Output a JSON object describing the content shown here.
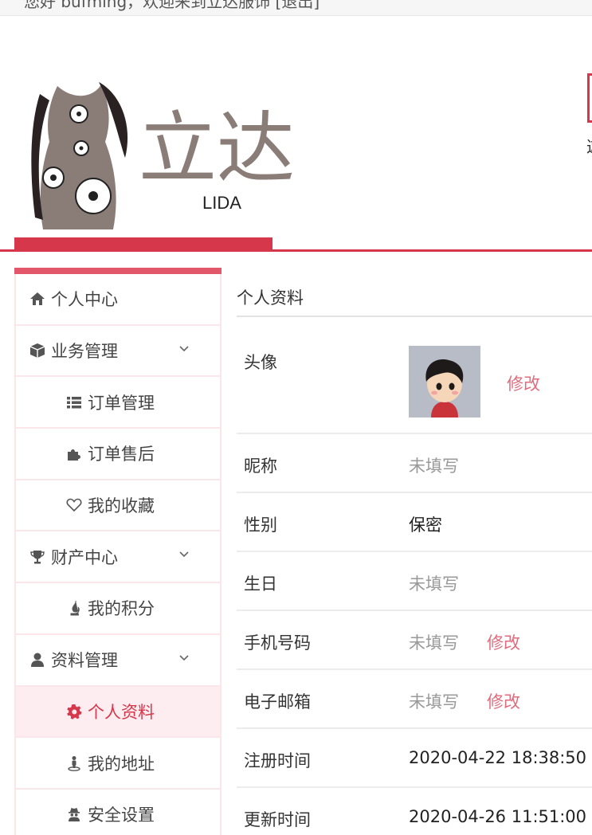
{
  "topbar": {
    "greeting": "您好 bufming，欢迎来到立达服饰 [退出]"
  },
  "logo": {
    "brand_cn": "立达",
    "brand_en": "LIDA"
  },
  "header": {
    "right_peek_char": "这"
  },
  "sidebar": {
    "items": [
      {
        "label": "个人中心",
        "icon": "home-icon",
        "kind": "parent"
      },
      {
        "label": "业务管理",
        "icon": "cube-icon",
        "kind": "parent",
        "expandable": true
      },
      {
        "label": "订单管理",
        "icon": "list-icon",
        "kind": "child"
      },
      {
        "label": "订单售后",
        "icon": "puzzle-icon",
        "kind": "child"
      },
      {
        "label": "我的收藏",
        "icon": "heart-icon",
        "kind": "child"
      },
      {
        "label": "财产中心",
        "icon": "trophy-icon",
        "kind": "parent",
        "expandable": true
      },
      {
        "label": "我的积分",
        "icon": "fire-icon",
        "kind": "child"
      },
      {
        "label": "资料管理",
        "icon": "user-icon",
        "kind": "parent",
        "expandable": true
      },
      {
        "label": "个人资料",
        "icon": "gear-icon",
        "kind": "child",
        "active": true
      },
      {
        "label": "我的地址",
        "icon": "street-view-icon",
        "kind": "child"
      },
      {
        "label": "安全设置",
        "icon": "user-secret-icon",
        "kind": "child"
      }
    ]
  },
  "profile": {
    "title": "个人资料",
    "rows": [
      {
        "label": "头像",
        "type": "avatar",
        "edit": "修改"
      },
      {
        "label": "昵称",
        "value": "未填写",
        "muted": true
      },
      {
        "label": "性别",
        "value": "保密",
        "muted": false
      },
      {
        "label": "生日",
        "value": "未填写",
        "muted": true
      },
      {
        "label": "手机号码",
        "value": "未填写",
        "muted": true,
        "edit": "修改"
      },
      {
        "label": "电子邮箱",
        "value": "未填写",
        "muted": true,
        "edit": "修改"
      },
      {
        "label": "注册时间",
        "value": "2020-04-22 18:38:50",
        "muted": false
      },
      {
        "label": "更新时间",
        "value": "2020-04-26 11:51:00",
        "muted": false
      }
    ]
  },
  "colors": {
    "accent": "#d6374a",
    "edit": "#e06c7d",
    "active_bg": "#fdedf0"
  }
}
